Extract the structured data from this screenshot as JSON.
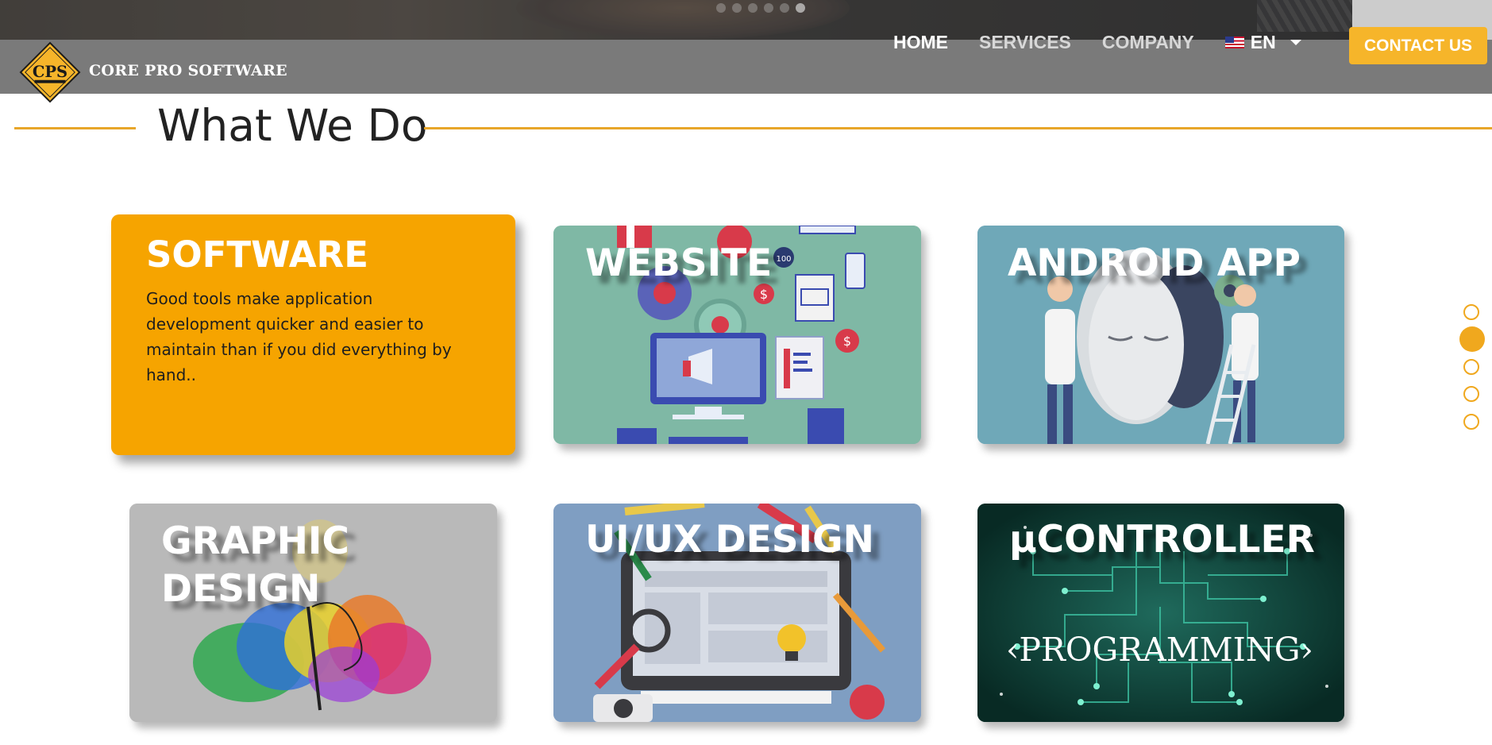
{
  "brand": {
    "name": "CORE PRO SOFTWARE",
    "logo_letters": "CPS",
    "accent_color": "#f6b52a"
  },
  "carousel": {
    "slide_count": 6,
    "active_index": 5
  },
  "nav": {
    "home": "HOME",
    "services": "SERVICES",
    "company": "COMPANY",
    "language": "EN",
    "language_flag": "us-flag-icon",
    "contact": "CONTACT US"
  },
  "section": {
    "title": "What We Do"
  },
  "cards": {
    "software": {
      "title": "SOFTWARE",
      "description": "Good tools make application development quicker and easier to maintain than if you did everything by hand.."
    },
    "website": {
      "title": "WEBSITE"
    },
    "android": {
      "title": "ANDROID APP"
    },
    "graphic": {
      "title": "GRAPHIC DESIGN"
    },
    "uiux": {
      "title": "UI/UX DESIGN"
    },
    "micro": {
      "title": "μCONTROLLER",
      "subtitle": "‹PROGRAMMING›"
    }
  },
  "side_nav": {
    "count": 5,
    "active_index": 1
  }
}
